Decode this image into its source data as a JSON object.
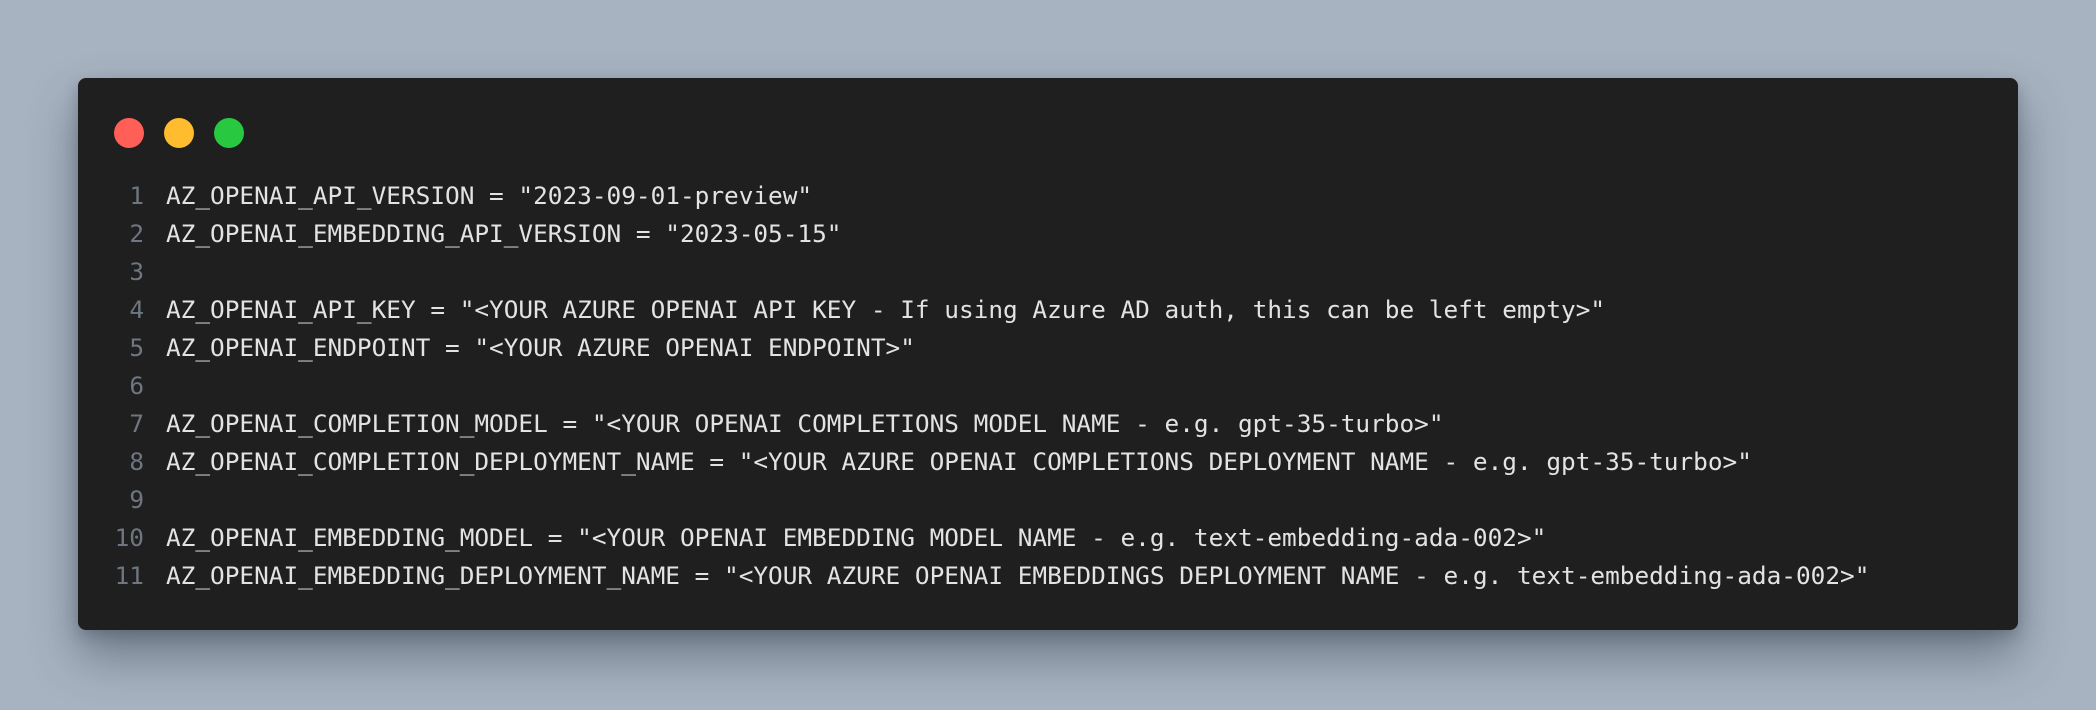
{
  "window": {
    "traffic_lights": {
      "close_color": "#ff5f57",
      "minimize_color": "#febc2e",
      "maximize_color": "#28c840"
    }
  },
  "code": {
    "lines": [
      {
        "number": "1",
        "text": "AZ_OPENAI_API_VERSION = \"2023-09-01-preview\""
      },
      {
        "number": "2",
        "text": "AZ_OPENAI_EMBEDDING_API_VERSION = \"2023-05-15\""
      },
      {
        "number": "3",
        "text": ""
      },
      {
        "number": "4",
        "text": "AZ_OPENAI_API_KEY = \"<YOUR AZURE OPENAI API KEY - If using Azure AD auth, this can be left empty>\""
      },
      {
        "number": "5",
        "text": "AZ_OPENAI_ENDPOINT = \"<YOUR AZURE OPENAI ENDPOINT>\""
      },
      {
        "number": "6",
        "text": ""
      },
      {
        "number": "7",
        "text": "AZ_OPENAI_COMPLETION_MODEL = \"<YOUR OPENAI COMPLETIONS MODEL NAME - e.g. gpt-35-turbo>\""
      },
      {
        "number": "8",
        "text": "AZ_OPENAI_COMPLETION_DEPLOYMENT_NAME = \"<YOUR AZURE OPENAI COMPLETIONS DEPLOYMENT NAME - e.g. gpt-35-turbo>\""
      },
      {
        "number": "9",
        "text": ""
      },
      {
        "number": "10",
        "text": "AZ_OPENAI_EMBEDDING_MODEL = \"<YOUR OPENAI EMBEDDING MODEL NAME - e.g. text-embedding-ada-002>\""
      },
      {
        "number": "11",
        "text": "AZ_OPENAI_EMBEDDING_DEPLOYMENT_NAME = \"<YOUR AZURE OPENAI EMBEDDINGS DEPLOYMENT NAME - e.g. text-embedding-ada-002>\""
      }
    ]
  }
}
